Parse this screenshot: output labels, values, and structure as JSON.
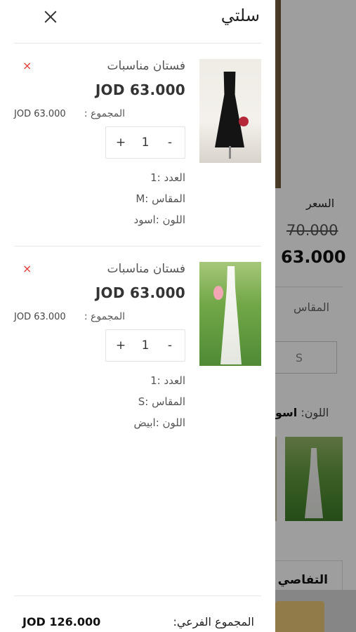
{
  "background": {
    "price_label": "السعر",
    "old_price": "70.000",
    "new_price": "63.000",
    "size_label": "المقاس",
    "size_option": "S",
    "color_label": "اللون:",
    "color_value": "اسو",
    "details_label": "التفاصي"
  },
  "cart": {
    "title": "سلتي",
    "close_icon": "close-icon",
    "remove_icon": "×",
    "items": [
      {
        "name": "فستان مناسبات",
        "price": "JOD 63.000",
        "total_label": "المجموع :",
        "total_value": "JOD 63.000",
        "quantity": "1",
        "minus": "-",
        "plus": "+",
        "count_line": "العدد :1",
        "size_line": "المقاس :M",
        "color_line": "اللون :اسود"
      },
      {
        "name": "فستان مناسبات",
        "price": "JOD 63.000",
        "total_label": "المجموع :",
        "total_value": "JOD 63.000",
        "quantity": "1",
        "minus": "-",
        "plus": "+",
        "count_line": "العدد :1",
        "size_line": "المقاس :S",
        "color_line": "اللون :ابيض"
      }
    ],
    "subtotal_label": "المجموع الفرعي:",
    "subtotal_value": "JOD 126.000"
  },
  "colors": {
    "remove": "#e53935",
    "cta": "#e9c777",
    "overlay": "rgba(0,0,0,0.38)"
  }
}
